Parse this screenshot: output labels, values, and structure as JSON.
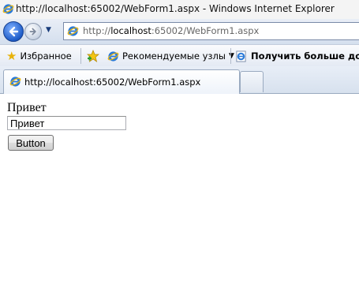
{
  "window": {
    "title": "http://localhost:65002/WebForm1.aspx - Windows Internet Explorer"
  },
  "address_bar": {
    "url_prefix": "http://",
    "url_host": "localhost",
    "url_rest": ":65002/WebForm1.aspx"
  },
  "favorites_bar": {
    "favorites_label": "Избранное",
    "suggested_sites_label": "Рекомендуемые узлы",
    "get_more_label": "Получить больше до..."
  },
  "tabs": [
    {
      "label": "http://localhost:65002/WebForm1.aspx"
    }
  ],
  "page": {
    "label_text": "Привет",
    "textbox_value": "Привет",
    "button_label": "Button"
  },
  "icons": {
    "ie": "ie-icon",
    "back": "back-arrow-icon",
    "forward": "forward-arrow-icon",
    "favorites": "favorites-star-icon",
    "add_favorites": "add-favorites-icon"
  }
}
